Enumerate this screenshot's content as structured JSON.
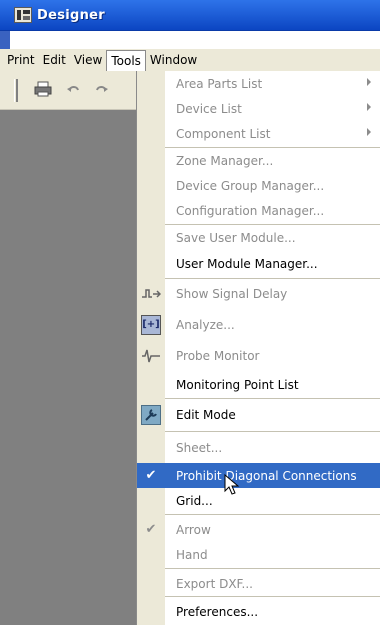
{
  "window": {
    "title": "Designer"
  },
  "menubar": [
    "Print",
    "Edit",
    "View",
    "Tools",
    "Window"
  ],
  "toolbar": {
    "icons": [
      "printer-icon",
      "undo-icon",
      "redo-icon"
    ]
  },
  "tools_menu": {
    "items": {
      "area_parts_list": "Area Parts List",
      "device_list": "Device List",
      "component_list": "Component List",
      "zone_manager": "Zone Manager...",
      "device_group_manager": "Device Group Manager...",
      "configuration_manager": "Configuration Manager...",
      "save_user_module": "Save User Module...",
      "user_module_manager": "User Module Manager...",
      "show_signal_delay": "Show Signal Delay",
      "analyze": "Analyze...",
      "probe_monitor": "Probe Monitor",
      "monitoring_point_list": "Monitoring Point List",
      "edit_mode": "Edit Mode",
      "sheet": "Sheet...",
      "prohibit_diagonal_connections": "Prohibit Diagonal Connections",
      "grid": "Grid...",
      "arrow": "Arrow",
      "hand": "Hand",
      "export_dxf": "Export DXF...",
      "preferences": "Preferences..."
    },
    "highlighted": "prohibit_diagonal_connections",
    "checked": [
      "prohibit_diagonal_connections",
      "arrow"
    ]
  },
  "colors": {
    "titlebar": "#0b45c2",
    "highlight": "#316ac5",
    "workspace": "#808080",
    "menu_gutter": "#ece9d8"
  }
}
